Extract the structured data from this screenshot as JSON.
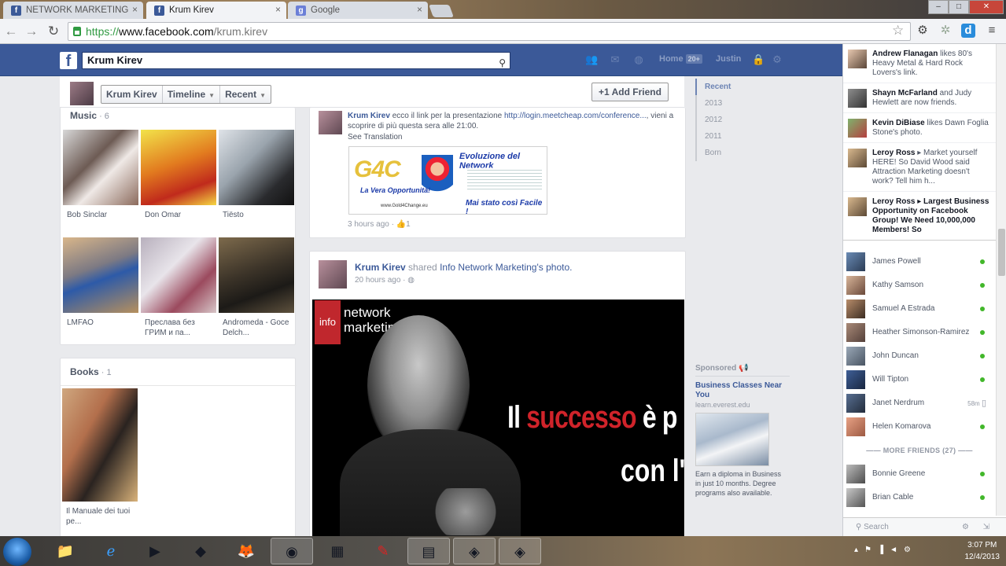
{
  "browser": {
    "tabs": [
      {
        "title": "NETWORK MARKETING",
        "favicon": "facebook-icon",
        "active": false
      },
      {
        "title": "Krum Kirev",
        "favicon": "facebook-icon",
        "active": true
      },
      {
        "title": "Google",
        "favicon": "google-icon",
        "active": false
      }
    ],
    "url_scheme": "https://",
    "url_host": "www.facebook.com",
    "url_path": "/krum.kirev"
  },
  "fb_header": {
    "search_value": "Krum Kirev",
    "home_label": "Home",
    "home_badge": "20+",
    "user_label": "Justin",
    "brand_color": "#3b5998"
  },
  "timeline_bar": {
    "name_button": "Krum Kirev",
    "timeline_button": "Timeline",
    "recent_button": "Recent",
    "add_friend_button": "Add Friend"
  },
  "music": {
    "title": "Music",
    "count": "· 6",
    "items": [
      {
        "label": "Bob Sinclar"
      },
      {
        "label": "Don Omar"
      },
      {
        "label": "Tiësto"
      },
      {
        "label": "LMFAO"
      },
      {
        "label": "Преслава без ГРИМ и па..."
      },
      {
        "label": "Andromeda - Goce Delch..."
      }
    ]
  },
  "books": {
    "title": "Books",
    "count": "· 1",
    "items": [
      {
        "label": "Il Manuale dei tuoi pe..."
      }
    ]
  },
  "post1": {
    "author": "Krum Kirev",
    "text": "ecco il link per la presentazione",
    "link": "http://login.meetcheap.com/conference...",
    "text2": ", vieni a scoprire di più questa sera alle 21:00.",
    "see_translation": "See Translation",
    "time": "3 hours ago",
    "likes": "1",
    "image_text": {
      "brand": "G4C",
      "headline": "Evoluzione del Network",
      "tagline": "La Vera Opportunità!",
      "footer": "Mai stato così Facile !",
      "site": "www.Gold4Change.eu"
    }
  },
  "post2": {
    "author": "Krum Kirev",
    "shared": "shared",
    "page": "Info Network Marketing",
    "object": "'s photo.",
    "time": "20 hours ago",
    "image_text": {
      "logo_info": "info",
      "logo_line1": "network",
      "logo_line2": "marketing",
      "quote_pre": "Il ",
      "quote_red": "successo",
      "quote_post": " è p",
      "quote_line2": "con l'a"
    }
  },
  "timeline_nav": {
    "items": [
      "Recent",
      "2013",
      "2012",
      "2011",
      "Born"
    ]
  },
  "sponsored": {
    "heading": "Sponsored",
    "ad_title": "Business Classes Near You",
    "ad_url": "learn.everest.edu",
    "ad_body": "Earn a diploma in Business in just 10 months. Degree programs also available."
  },
  "ticker": [
    {
      "name": "Andrew Flanagan",
      "text": " likes 80's Heavy Metal & Hard Rock Lovers's link."
    },
    {
      "name": "Shayn McFarland",
      "text": " and Judy Hewlett are now friends."
    },
    {
      "name": "Kevin DiBiase",
      "text": " likes Dawn Foglia Stone's photo."
    },
    {
      "name": "Leroy Ross",
      "text": " ▸ Market yourself HERE! So David Wood said Attraction Marketing doesn't work? Tell him h..."
    },
    {
      "name": "Leroy Ross",
      "text": " ▸ Largest Business Opportunity on Facebook Group! We Need 10,000,000 Members! So"
    }
  ],
  "chat": {
    "friends": [
      {
        "name": "James Powell",
        "status": "online"
      },
      {
        "name": "Kathy Samson",
        "status": "online"
      },
      {
        "name": "Samuel A Estrada",
        "status": "online"
      },
      {
        "name": "Heather Simonson-Ramirez",
        "status": "online"
      },
      {
        "name": "John Duncan",
        "status": "online"
      },
      {
        "name": "Will Tipton",
        "status": "online"
      },
      {
        "name": "Janet Nerdrum",
        "status": "mobile",
        "idle": "58m"
      },
      {
        "name": "Helen Komarova",
        "status": "online"
      }
    ],
    "more_label": "MORE FRIENDS (27)",
    "more": [
      {
        "name": "Bonnie Greene",
        "status": "online"
      },
      {
        "name": "Brian Cable",
        "status": "online"
      }
    ],
    "search_placeholder": "Search"
  },
  "taskbar": {
    "time": "3:07 PM",
    "date": "12/4/2013"
  }
}
